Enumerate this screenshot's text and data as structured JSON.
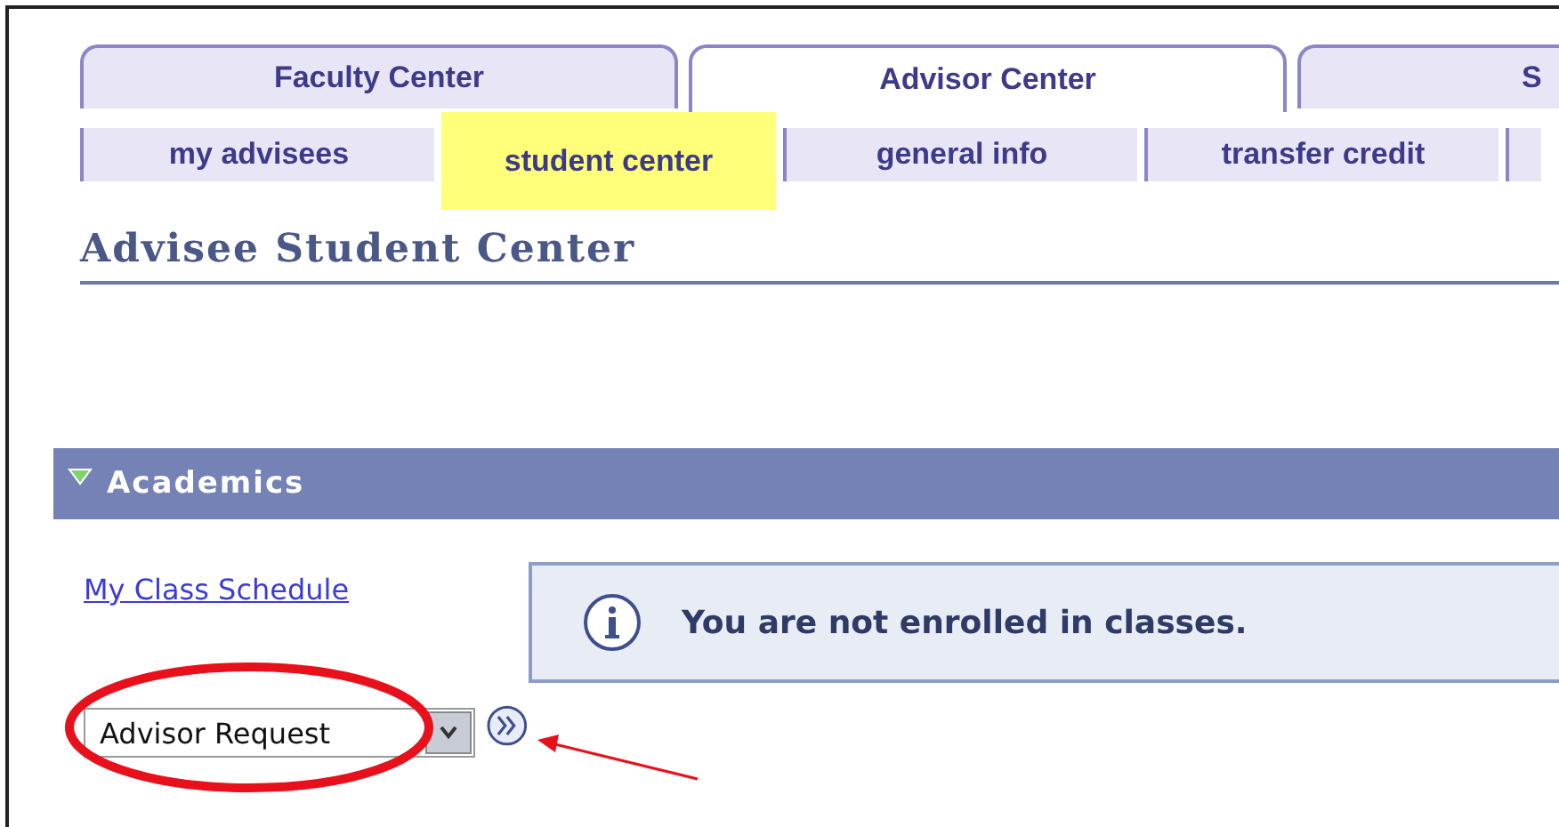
{
  "tabs": [
    {
      "label": "Faculty Center",
      "selected": false
    },
    {
      "label": "Advisor Center",
      "selected": true
    },
    {
      "label": "S",
      "selected": false
    }
  ],
  "subtabs": [
    {
      "label": "my advisees",
      "selected": false
    },
    {
      "label": "student center",
      "selected": true
    },
    {
      "label": "general info",
      "selected": false
    },
    {
      "label": "transfer credit",
      "selected": false
    }
  ],
  "page_title": "Advisee Student Center",
  "section": {
    "title": "Academics",
    "expanded": true
  },
  "link": "My Class Schedule",
  "info_message": "You are not enrolled in classes.",
  "select": {
    "value": "Advisor Request"
  }
}
